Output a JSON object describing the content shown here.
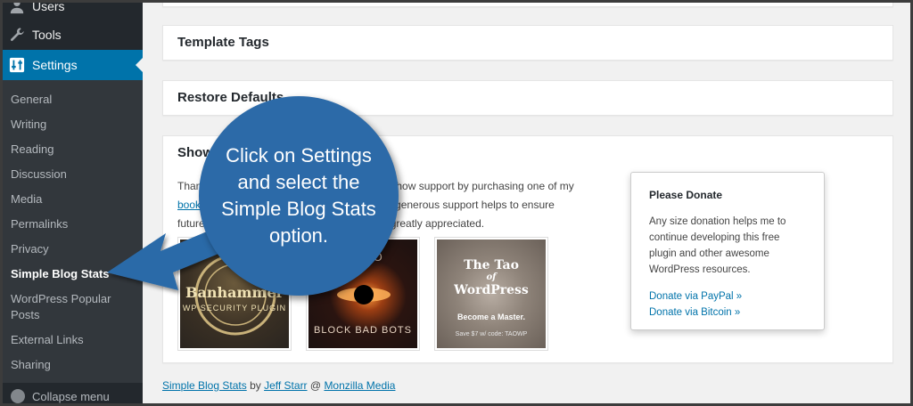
{
  "sidebar": {
    "users_label": "Users",
    "tools_label": "Tools",
    "settings_label": "Settings",
    "submenu": [
      "General",
      "Writing",
      "Reading",
      "Discussion",
      "Media",
      "Permalinks",
      "Privacy",
      "Simple Blog Stats",
      "WordPress Popular Posts",
      "External Links",
      "Sharing"
    ],
    "collapse_label": "Collapse menu"
  },
  "panels": {
    "template_tags": "Template Tags",
    "restore_defaults": "Restore Defaults",
    "show_support": "Show S"
  },
  "support": {
    "line1_a": "Thank",
    "line1_b": "show support by purchasing one of my",
    "line2_link": "books",
    "line2_b": "ur generous support helps to ensure",
    "line3_a": "future",
    "line3_b": "greatly appreciated."
  },
  "books": [
    {
      "title": "Banhammer",
      "subtitle": "WP SECURITY PLUGIN"
    },
    {
      "top": "E PRO",
      "bottom": "BLOCK BAD BOTS"
    },
    {
      "title_a": "The Tao",
      "title_b": "of",
      "title_c": "WordPress",
      "subtitle": "Become a Master.",
      "promo": "Save $7 w/ code: TAOWP"
    }
  ],
  "donate": {
    "title": "Please Donate",
    "body": "Any size donation helps me to continue developing this free plugin and other awesome WordPress resources.",
    "paypal": "Donate via PayPal »",
    "bitcoin": "Donate via Bitcoin »"
  },
  "footer": {
    "plugin": "Simple Blog Stats",
    "by": "by",
    "author": "Jeff Starr",
    "at": "@",
    "company": "Monzilla Media"
  },
  "callout": {
    "text": "Click on Settings and select the Simple Blog Stats option."
  },
  "colors": {
    "sidebar_bg": "#23282d",
    "submenu_bg": "#32373c",
    "accent": "#0073aa",
    "callout": "#2c6aa8"
  }
}
